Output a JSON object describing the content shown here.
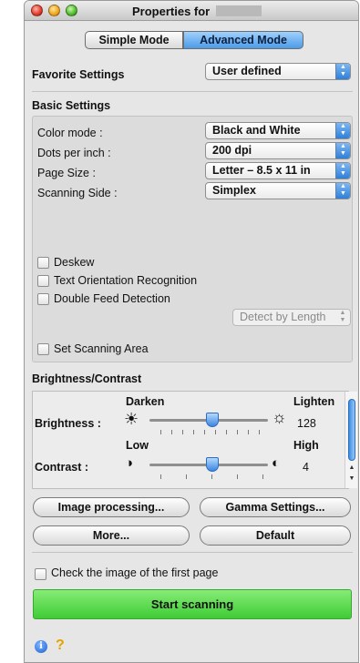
{
  "window": {
    "title": "Properties for"
  },
  "modes": {
    "simple": "Simple Mode",
    "advanced": "Advanced Mode"
  },
  "favorite": {
    "label": "Favorite Settings",
    "value": "User defined"
  },
  "basic": {
    "heading": "Basic Settings",
    "color_mode": {
      "label": "Color mode :",
      "value": "Black and White"
    },
    "dpi": {
      "label": "Dots per inch :",
      "value": "200 dpi"
    },
    "page_size": {
      "label": "Page Size :",
      "value": "Letter – 8.5 x 11 in"
    },
    "side": {
      "label": "Scanning Side :",
      "value": "Simplex"
    },
    "deskew": "Deskew",
    "text_orientation": "Text Orientation Recognition",
    "double_feed": "Double Feed Detection",
    "detect_by": "Detect by Length",
    "set_area": "Set Scanning Area"
  },
  "brightness_contrast": {
    "heading": "Brightness/Contrast",
    "brightness": {
      "label": "Brightness :",
      "low": "Darken",
      "high": "Lighten",
      "value": "128"
    },
    "contrast": {
      "label": "Contrast :",
      "low": "Low",
      "high": "High",
      "value": "4"
    }
  },
  "buttons": {
    "image_processing": "Image processing...",
    "gamma": "Gamma Settings...",
    "more": "More...",
    "default": "Default",
    "start": "Start scanning"
  },
  "check_first_page": "Check the image of the first page",
  "colors": {
    "accent": "#3f8de0",
    "start": "#4fd244"
  }
}
